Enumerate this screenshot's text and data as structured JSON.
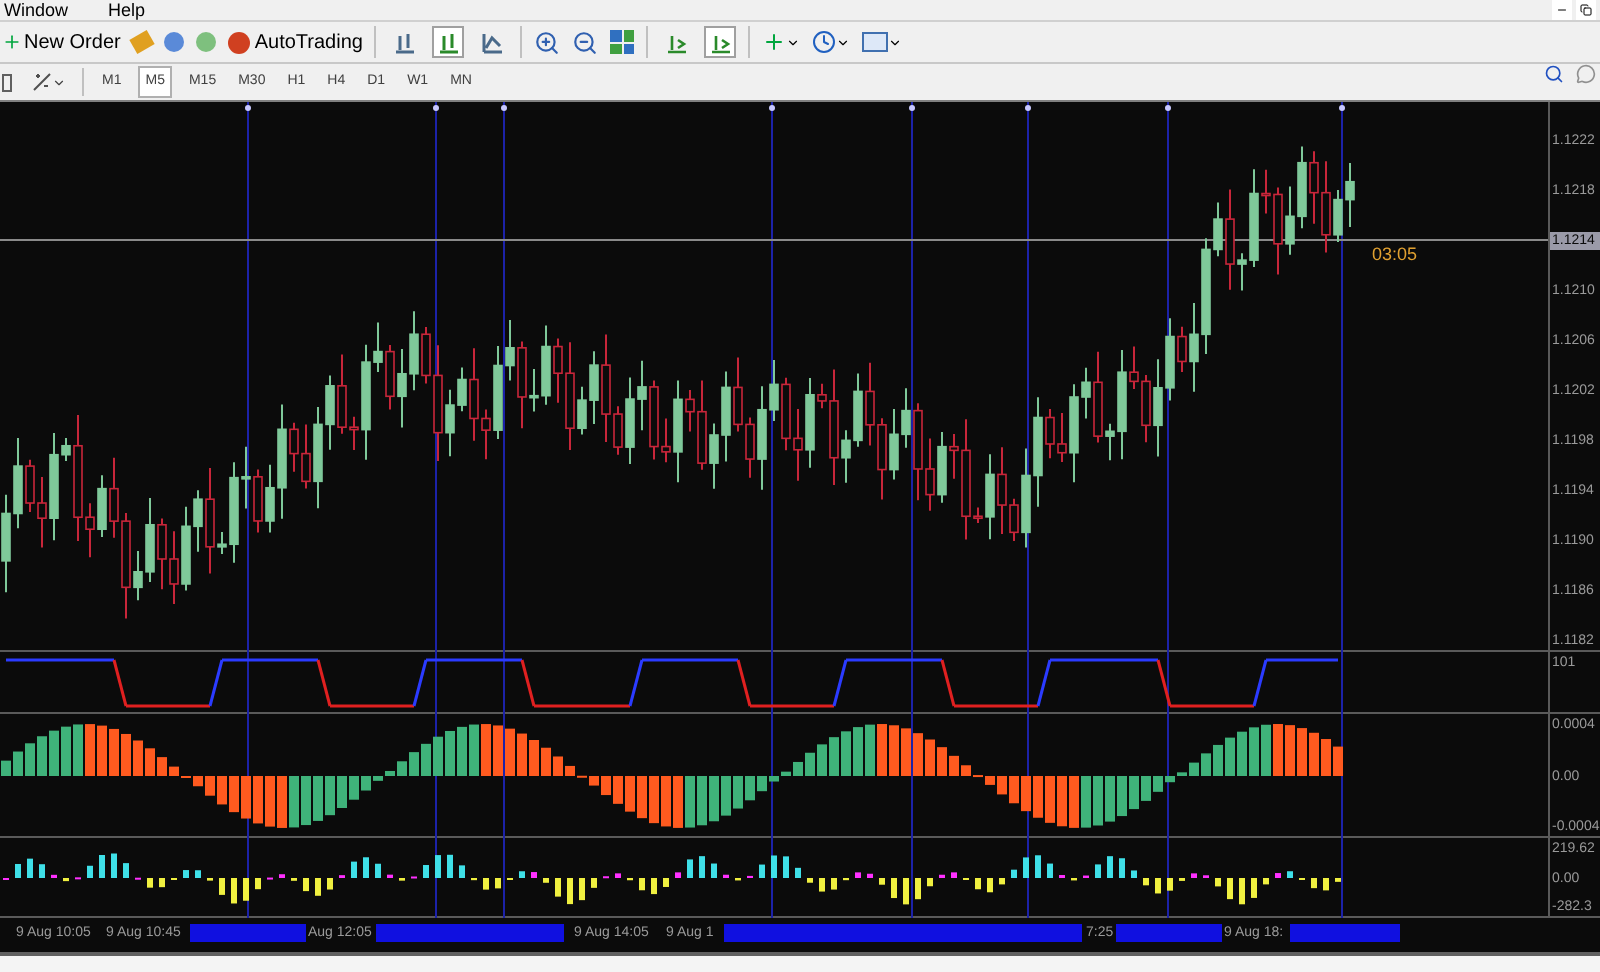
{
  "menu": [
    {
      "label": "Window"
    },
    {
      "label": "Help"
    }
  ],
  "toolbar": {
    "new_order": "New Order",
    "autotrading": "AutoTrading"
  },
  "chart_types": [
    {
      "selected": false
    },
    {
      "selected": true
    },
    {
      "selected": false
    }
  ],
  "chart_toggles": [
    {
      "selected": false
    },
    {
      "selected": true
    }
  ],
  "timeframes": [
    {
      "label": "M1",
      "selected": false
    },
    {
      "label": "M5",
      "selected": true
    },
    {
      "label": "M15",
      "selected": false
    },
    {
      "label": "M30",
      "selected": false
    },
    {
      "label": "H1",
      "selected": false
    },
    {
      "label": "H4",
      "selected": false
    },
    {
      "label": "D1",
      "selected": false
    },
    {
      "label": "W1",
      "selected": false
    },
    {
      "label": "MN",
      "selected": false
    }
  ],
  "price_axis": [
    {
      "label": "1.1222",
      "current": false
    },
    {
      "label": "1.1218",
      "current": false
    },
    {
      "label": "1.1214",
      "current": true
    },
    {
      "label": "1.1210",
      "current": false
    },
    {
      "label": "1.1206",
      "current": false
    },
    {
      "label": "1.1202",
      "current": false
    },
    {
      "label": "1.1198",
      "current": false
    },
    {
      "label": "1.1194",
      "current": false
    },
    {
      "label": "1.1190",
      "current": false
    },
    {
      "label": "1.1186",
      "current": false
    },
    {
      "label": "1.1182",
      "current": false
    }
  ],
  "timer": "03:05",
  "indicator_axes": [
    [
      "101"
    ],
    [
      "0.0004",
      "0.00",
      "-0.0004"
    ],
    [
      "219.62",
      "0.00",
      "-282.3"
    ]
  ],
  "time_axis": [
    "9 Aug 10:05",
    "9 Aug 10:45",
    "Aug 12:05",
    "9 Aug 14:05",
    "9 Aug 1",
    "7:25",
    "9 Aug 18:"
  ]
}
